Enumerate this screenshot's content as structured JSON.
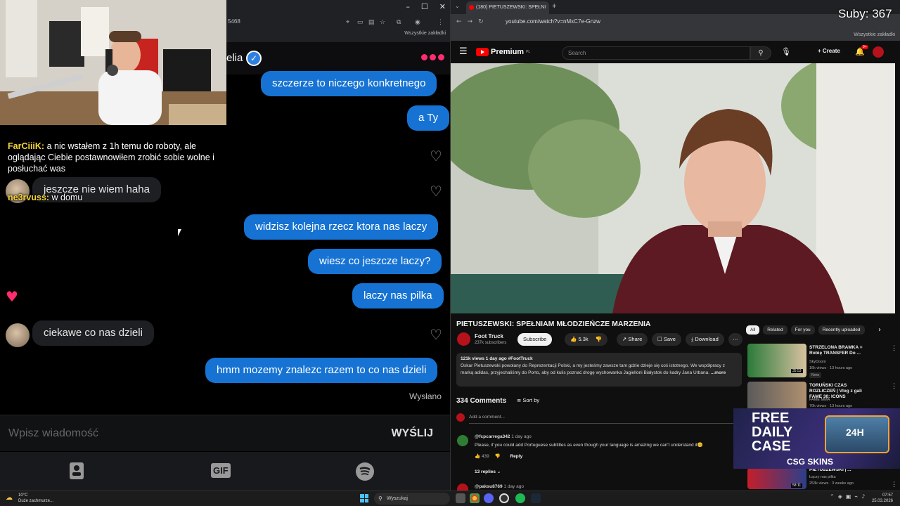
{
  "overlay": {
    "subs_label": "Suby: 367"
  },
  "twitch_chat": [
    {
      "user": "FarCiiiK:",
      "user_color": "#f5d63a",
      "text": "a nic wstałem z 1h temu do roboty, ale oglądając Ciebie postawnowiłem zrobić sobie wolne i posłuchać was"
    },
    {
      "user": "ne3rvuss:",
      "user_color": "#f5d63a",
      "text": "w domu"
    }
  ],
  "left_browser": {
    "address_fragment": "5468",
    "bookmarks_label": "Wszystkie zakładki"
  },
  "chat_app": {
    "contact_name_fragment": "elia",
    "messages": [
      {
        "dir": "out",
        "text": "szczerze to niczego konkretnego"
      },
      {
        "dir": "out",
        "text": "a Ty"
      },
      {
        "dir": "in",
        "text": "jeszcze nie wiem haha"
      },
      {
        "dir": "out",
        "text": "widzisz kolejna rzecz ktora nas laczy"
      },
      {
        "dir": "out",
        "text": "wiesz co jeszcze laczy?"
      },
      {
        "dir": "out",
        "text": "laczy nas pilka"
      },
      {
        "dir": "in",
        "text": "ciekawe co nas dzieli"
      },
      {
        "dir": "out",
        "text": "hmm mozemy znalezc razem to co nas dzieli"
      }
    ],
    "sent_status": "Wysłano",
    "composer_placeholder": "Wpisz wiadomość",
    "send_label": "WYŚLIJ",
    "tabs": {
      "gif_label": "GIF"
    },
    "accent": "#1673d3",
    "like_color": "#ff2d6f"
  },
  "youtube": {
    "tab_title": "(180) PIETUSZEWSKI: SPEŁNI",
    "url": "youtube.com/watch?v=nMxC7e-Gnzw",
    "bookmarks_label": "Wszystkie zakładki",
    "logo_text": "Premium",
    "logo_suffix": "PL",
    "search_placeholder": "Search",
    "create_label": "Create",
    "notif_badge": "9+",
    "video_title": "PIETUSZEWSKI: SPEŁNIAM MŁODZIEŃCZE MARZENIA",
    "channel_name": "Foot Truck",
    "channel_subs": "237k subscribers",
    "subscribe_label": "Subscribe",
    "likes": "5.3k",
    "share_label": "Share",
    "save_label": "Save",
    "download_label": "Download",
    "desc_meta": "121k views  1 day ago  #FootTruck",
    "desc_text": "Oskar Pietuszewski powołany do Reprezentacji Polski, a my jesteśmy zawsze tam gdzie dzieje się coś istotnego. We współpracy z marką adidas, przyjechaliśmy do Porto, aby od kulis poznać drogę wychowanka Jagielloni Białystok do kadry Jana Urbana.",
    "desc_more": "...more",
    "comments_count": "334 Comments",
    "sort_label": "Sort by",
    "add_comment_placeholder": "Add a comment...",
    "comments": [
      {
        "author": "@fcpcarrega342",
        "age": "1 day ago",
        "text": "Please, if you could add Portuguese subtitles as even though your language is amazing we can't understand it😊",
        "likes": "439",
        "reply_label": "Reply",
        "replies": "13 replies"
      },
      {
        "author": "@paksu8769",
        "age": "1 day ago"
      }
    ],
    "filters": [
      "All",
      "Related",
      "For you",
      "Recently uploaded"
    ],
    "related": [
      {
        "title": "STRZELONA BRAMKA = Robię TRANSFER Do ...",
        "channel": "SkyDoom",
        "meta": "16k views · 13 hours ago",
        "badge": "New",
        "duration": "35:53"
      },
      {
        "title": "TORUŃSKI CZAS ROZLICZEŃ | Vlog z gali FAME 30: ICONS",
        "channel": "FAME MMA",
        "meta": "70k views · 13 hours ago"
      },
      {
        "title": "PIETUSZEWSKI | ...",
        "channel": "Łączy nas piłka",
        "meta": "253k views · 3 weeks ago",
        "duration": "58:11"
      }
    ]
  },
  "ad": {
    "line1": "FREE",
    "line2": "DAILY",
    "line3": "CASE",
    "brand": "CSG SKINS",
    "tag": "24H"
  },
  "taskbar": {
    "temp": "10°C",
    "weather": "Duże zachmurze...",
    "search_label": "Wyszukaj",
    "time": "07:57",
    "date": "25.03.2026"
  }
}
